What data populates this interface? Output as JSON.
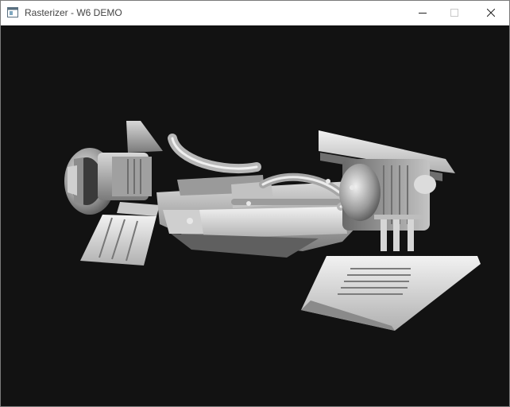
{
  "window": {
    "title": "Rasterizer - W6 DEMO",
    "icons": {
      "app": "window-app-icon",
      "minimize": "minimize-icon",
      "maximize": "maximize-icon",
      "close": "close-icon"
    }
  },
  "viewport": {
    "background": "#121212",
    "model": "rendered-hovercraft-model"
  },
  "colors": {
    "titlebar": "#ffffff",
    "title_text": "#444444",
    "model_light": "#e6e6e6",
    "model_mid": "#a8a8a8",
    "model_dark": "#5c5c5c"
  }
}
